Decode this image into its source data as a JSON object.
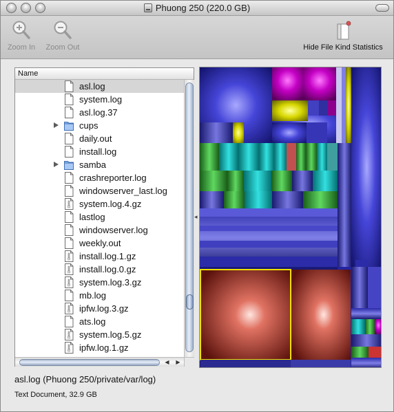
{
  "window": {
    "title": "Phuong 250 (220.0 GB)"
  },
  "toolbar": {
    "zoom_in_label": "Zoom In",
    "zoom_out_label": "Zoom Out",
    "hide_stats_label": "Hide File Kind Statistics"
  },
  "file_list": {
    "column_header": "Name",
    "rows": [
      {
        "label": "asl.log",
        "icon": "document-icon",
        "selected": true
      },
      {
        "label": "system.log",
        "icon": "document-icon"
      },
      {
        "label": "asl.log.37",
        "icon": "document-icon"
      },
      {
        "label": "cups",
        "icon": "folder-icon",
        "expandable": true
      },
      {
        "label": "daily.out",
        "icon": "document-icon"
      },
      {
        "label": "install.log",
        "icon": "document-icon"
      },
      {
        "label": "samba",
        "icon": "folder-icon",
        "expandable": true
      },
      {
        "label": "crashreporter.log",
        "icon": "document-icon"
      },
      {
        "label": "windowserver_last.log",
        "icon": "document-icon"
      },
      {
        "label": "system.log.4.gz",
        "icon": "archive-icon"
      },
      {
        "label": "lastlog",
        "icon": "document-icon"
      },
      {
        "label": "windowserver.log",
        "icon": "document-icon"
      },
      {
        "label": "weekly.out",
        "icon": "document-icon"
      },
      {
        "label": "install.log.1.gz",
        "icon": "archive-icon"
      },
      {
        "label": "install.log.0.gz",
        "icon": "archive-icon"
      },
      {
        "label": "system.log.3.gz",
        "icon": "archive-icon"
      },
      {
        "label": "mb.log",
        "icon": "document-icon"
      },
      {
        "label": "ipfw.log.3.gz",
        "icon": "archive-icon"
      },
      {
        "label": "ats.log",
        "icon": "document-icon"
      },
      {
        "label": "system.log.5.gz",
        "icon": "archive-icon"
      },
      {
        "label": "ipfw.log.1.gz",
        "icon": "archive-icon"
      }
    ]
  },
  "status": {
    "path": "asl.log (Phuong 250/private/var/log)",
    "kind": "Text Document, 32.9 GB"
  },
  "colors": {
    "treemap_blue": "#3b3bd0",
    "treemap_magenta": "#c800c8",
    "treemap_yellow": "#d8d800",
    "treemap_cyan": "#00c8c8",
    "treemap_green": "#33b533",
    "treemap_red": "#d24d3c",
    "selection_highlight": "#f0e000"
  }
}
